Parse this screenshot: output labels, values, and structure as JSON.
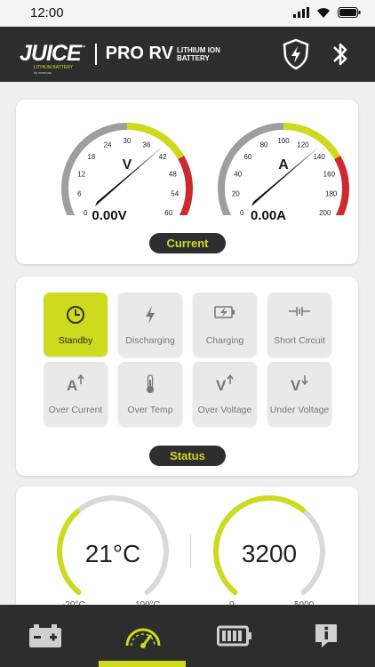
{
  "status_bar": {
    "time": "12:00"
  },
  "brand": {
    "logo": "JUICE",
    "logo_tm": "™",
    "logo_sub": "LITHIUM BATTERY",
    "logo_sub2": "by enerbac",
    "product": "PRO RV",
    "product_sub1": "LITHIUM ION",
    "product_sub2": "BATTERY"
  },
  "header_icons": [
    "shield-bolt-icon",
    "bluetooth-icon"
  ],
  "gauges": {
    "voltage": {
      "unit": "V",
      "value_text": "0.00V",
      "value": 0,
      "ticks": [
        "0",
        "6",
        "12",
        "18",
        "24",
        "30",
        "36",
        "42",
        "48",
        "54",
        "60"
      ]
    },
    "current": {
      "unit": "A",
      "value_text": "0.00A",
      "value": 0,
      "ticks": [
        "0",
        "20",
        "40",
        "60",
        "80",
        "100",
        "120",
        "140",
        "160",
        "180",
        "200"
      ]
    },
    "pill_label": "Current"
  },
  "status": {
    "tiles": [
      {
        "label": "Standby",
        "icon": "clock-icon",
        "active": true
      },
      {
        "label": "Discharging",
        "icon": "lightning-icon",
        "active": false
      },
      {
        "label": "Charging",
        "icon": "battery-charging-icon",
        "active": false
      },
      {
        "label": "Short Circuit",
        "icon": "short-circuit-icon",
        "active": false
      },
      {
        "label": "Over Current",
        "icon": "over-current-icon",
        "active": false
      },
      {
        "label": "Over Temp",
        "icon": "thermometer-icon",
        "active": false
      },
      {
        "label": "Over Voltage",
        "icon": "over-voltage-icon",
        "active": false
      },
      {
        "label": "Under Voltage",
        "icon": "under-voltage-icon",
        "active": false
      }
    ],
    "pill_label": "Status"
  },
  "bottom_gauges": {
    "temperature": {
      "value_text": "21°C",
      "min": "-20°C",
      "max": "100°C",
      "fraction": 0.35
    },
    "cycles": {
      "value_text": "3200",
      "min": "0",
      "max": "5000",
      "fraction": 0.64
    }
  },
  "nav": [
    {
      "icon": "battery-terminals-icon",
      "active": false
    },
    {
      "icon": "gauge-icon",
      "active": true
    },
    {
      "icon": "battery-level-icon",
      "active": false
    },
    {
      "icon": "info-icon",
      "active": false
    }
  ],
  "colors": {
    "accent": "#cdda1d",
    "dark": "#2d2d2d",
    "danger": "#cc2a2f",
    "grey": "#9e9e9e"
  }
}
